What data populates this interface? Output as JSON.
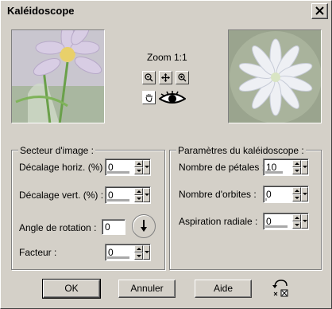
{
  "window": {
    "title": "Kaléidoscope"
  },
  "preview": {
    "zoom_label": "Zoom 1:1"
  },
  "icons": {
    "zoom_out": "zoom-out-icon",
    "pan": "move-icon",
    "zoom_in": "zoom-in-icon",
    "hand": "hand-icon",
    "eye": "eye-icon",
    "reset": "reset-icon",
    "close": "close-icon"
  },
  "sector": {
    "legend": "Secteur d'image :",
    "offset_h": {
      "label": "Décalage horiz. (%) :",
      "value": "0"
    },
    "offset_v": {
      "label": "Décalage vert. (%) :",
      "value": "0"
    },
    "rotation": {
      "label": "Angle de rotation :",
      "value": "0"
    },
    "factor": {
      "label": "Facteur :",
      "value": "0"
    }
  },
  "params": {
    "legend": "Paramètres du kaléidoscope :",
    "petals": {
      "label": "Nombre de pétales :",
      "value": "10"
    },
    "orbits": {
      "label": "Nombre d'orbites :",
      "value": "0"
    },
    "suction": {
      "label": "Aspiration radiale :",
      "value": "0"
    }
  },
  "buttons": {
    "ok": "OK",
    "cancel": "Annuler",
    "help": "Aide"
  },
  "colors": {
    "face": "#d4d0c8",
    "shadow": "#808080",
    "highlight": "#ffffff"
  }
}
